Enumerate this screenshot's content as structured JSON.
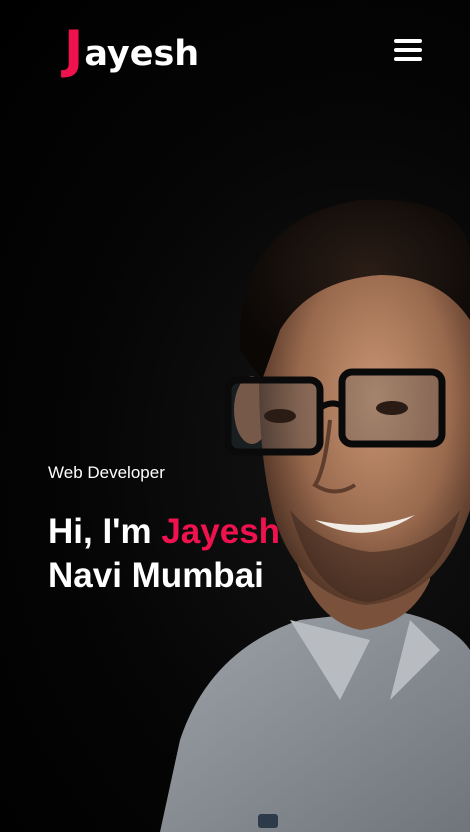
{
  "navbar": {
    "logo_initial": "J",
    "logo_rest": "ayesh",
    "menu_icon": "hamburger-menu-icon"
  },
  "hero": {
    "subtitle": "Web Developer",
    "greeting": "Hi, I'm ",
    "name": "Jayesh",
    "location": "Navi Mumbai",
    "photo_icon": "portrait-photo"
  },
  "colors": {
    "accent": "#f0124e",
    "background": "#000000",
    "text": "#ffffff"
  }
}
